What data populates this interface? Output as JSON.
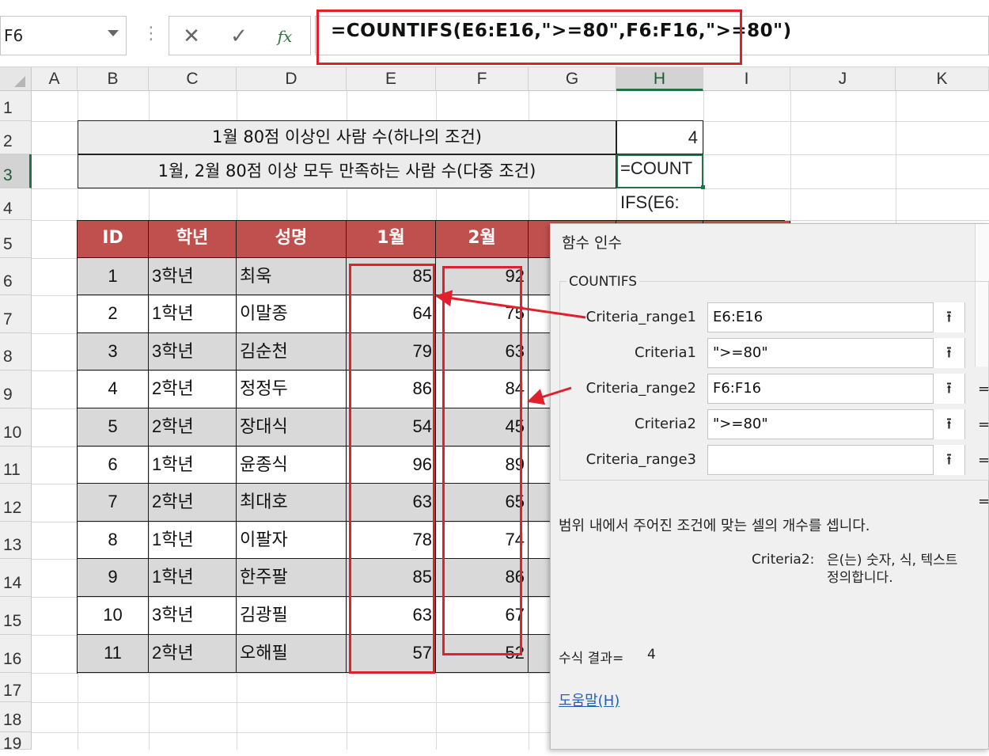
{
  "namebox": {
    "value": "F6"
  },
  "formula_bar": {
    "cancel_glyph": "✕",
    "enter_glyph": "✓",
    "fx_glyph": "fx",
    "formula": "=COUNTIFS(E6:E16,\">=80\",F6:F16,\">=80\")"
  },
  "columns": [
    "A",
    "B",
    "C",
    "D",
    "E",
    "F",
    "G",
    "H",
    "I",
    "J",
    "K"
  ],
  "rows": [
    "1",
    "2",
    "3",
    "4",
    "5",
    "6",
    "7",
    "8",
    "9",
    "10",
    "11",
    "12",
    "13",
    "14",
    "15",
    "16",
    "17",
    "18",
    "19"
  ],
  "summary": {
    "row2_label": "1월 80점 이상인 사람 수(하나의 조건)",
    "row2_value": "4",
    "row3_label": "1월, 2월 80점 이상 모두 만족하는 사람 수(다중 조건)",
    "row3_editing_line1": "=COUNT",
    "row3_editing_line2": "IFS(E6:"
  },
  "table": {
    "headers": [
      "ID",
      "학년",
      "성명",
      "1월",
      "2월"
    ],
    "rows": [
      [
        "1",
        "3학년",
        "최욱",
        "85",
        "92"
      ],
      [
        "2",
        "1학년",
        "이말종",
        "64",
        "75"
      ],
      [
        "3",
        "3학년",
        "김순천",
        "79",
        "63"
      ],
      [
        "4",
        "2학년",
        "정정두",
        "86",
        "84"
      ],
      [
        "5",
        "2학년",
        "장대식",
        "54",
        "45"
      ],
      [
        "6",
        "1학년",
        "윤종식",
        "96",
        "89"
      ],
      [
        "7",
        "2학년",
        "최대호",
        "63",
        "65"
      ],
      [
        "8",
        "1학년",
        "이팔자",
        "78",
        "74"
      ],
      [
        "9",
        "1학년",
        "한주팔",
        "85",
        "86"
      ],
      [
        "10",
        "3학년",
        "김광필",
        "63",
        "67"
      ],
      [
        "11",
        "2학년",
        "오해필",
        "57",
        "52"
      ]
    ]
  },
  "dialog": {
    "title": "함수 인수",
    "function_name": "COUNTIFS",
    "args": [
      {
        "label": "Criteria_range1",
        "value": "E6:E16"
      },
      {
        "label": "Criteria1",
        "value": "\">=80\""
      },
      {
        "label": "Criteria_range2",
        "value": "F6:F16"
      },
      {
        "label": "Criteria2",
        "value": "\">=80\""
      },
      {
        "label": "Criteria_range3",
        "value": ""
      }
    ],
    "collapse_glyph": "⭱",
    "eq_sign": "=",
    "description": "범위 내에서 주어진 조건에 맞는 셀의 개수를 셉니다.",
    "criteria_label": "Criteria2:",
    "criteria_desc_line1": "은(는) 숫자, 식, 텍스트",
    "criteria_desc_line2": "정의합니다.",
    "result_label": "수식 결과=",
    "result_value": "4",
    "help_link": "도움말(H)"
  },
  "colors": {
    "header_fill": "#c0504d",
    "row_shade": "#d9d9d9",
    "annotation_red": "#e0202c",
    "selection_green": "#217346"
  }
}
